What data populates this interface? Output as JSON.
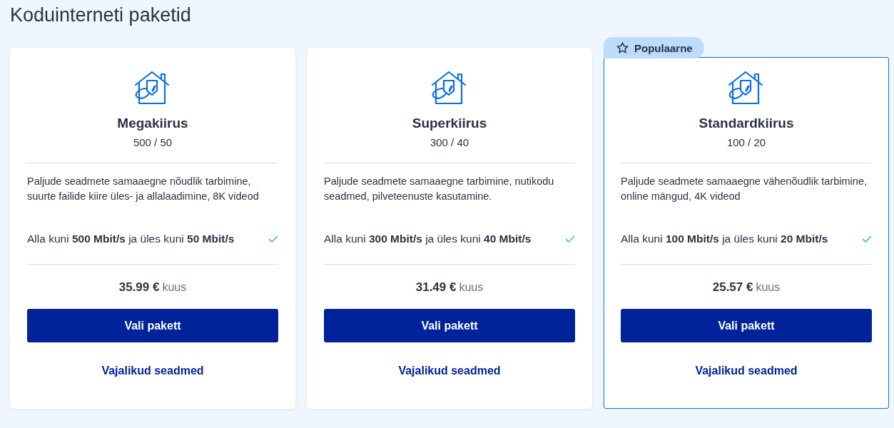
{
  "title": "Koduinterneti paketid",
  "plans": [
    {
      "name": "Megakiirus",
      "speeds": "500 / 50",
      "description": "Paljude seadmete samaaegne nõudlik tarbimine, suurte failide kiire üles- ja allalaadimine, 8K videod",
      "feature": "Alla kuni **500 Mbit/s** ja üles kuni **50 Mbit/s**",
      "included": true,
      "price": "35.99 €",
      "period": "kuus",
      "button": "Vali pakett",
      "link": "Vajalikud seadmed",
      "featured": false
    },
    {
      "name": "Superkiirus",
      "speeds": "300 / 40",
      "description": "Paljude seadmete samaaegne tarbimine, nutikodu seadmed, pilveteenuste kasutamine.",
      "feature": "Alla kuni **300 Mbit/s** ja üles kuni **40 Mbit/s**",
      "included": true,
      "price": "31.49 €",
      "period": "kuus",
      "button": "Vali pakett",
      "link": "Vajalikud seadmed",
      "featured": false
    },
    {
      "name": "Standardkiirus",
      "speeds": "100 / 20",
      "description": "Paljude seadmete samaaegne vähenõudlik tarbimine, online mängud, 4K videod",
      "feature": "Alla kuni **100 Mbit/s** ja üles kuni **20 Mbit/s**",
      "included": true,
      "price": "25.57 €",
      "period": "kuus",
      "button": "Vali pakett",
      "link": "Vajalikud seadmed",
      "featured": true,
      "badge": "Populaarne"
    }
  ]
}
